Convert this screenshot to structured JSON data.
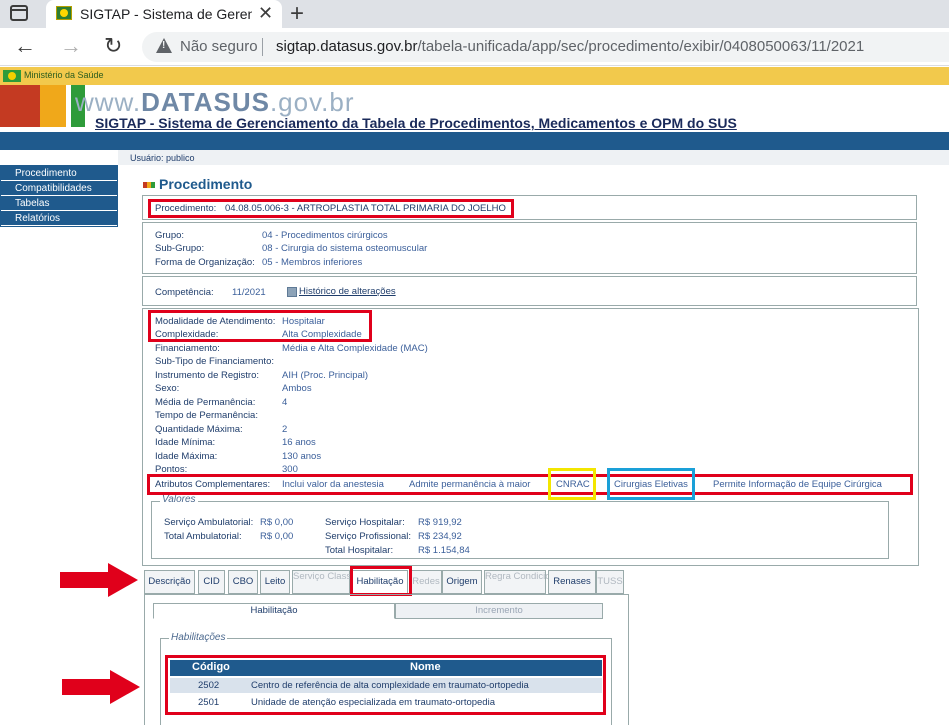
{
  "browser": {
    "tab_title": "SIGTAP - Sistema de Gerenciamento",
    "insecure_label": "Não seguro",
    "url_host": "sigtap.datasus.gov.br",
    "url_path": "/tabela-unificada/app/sec/procedimento/exibir/0408050063/11/2021"
  },
  "header": {
    "ministry": "Ministério da Saúde",
    "logo_prefix": "www.",
    "logo_main": "DATASUS",
    "logo_suffix": ".gov.br",
    "system_title": "SIGTAP - Sistema de Gerenciamento da Tabela de Procedimentos, Medicamentos e OPM do SUS",
    "user_label": "Usuário:",
    "user_value": "publico"
  },
  "menu": [
    "Procedimento",
    "Compatibilidades",
    "Tabelas",
    "Relatórios"
  ],
  "page_title": "Procedimento",
  "procedimento": {
    "label": "Procedimento:",
    "value": "04.08.05.006-3 - ARTROPLASTIA TOTAL PRIMARIA DO JOELHO"
  },
  "grupo": [
    {
      "label": "Grupo:",
      "value": "04 - Procedimentos cirúrgicos"
    },
    {
      "label": "Sub-Grupo:",
      "value": "08 - Cirurgia do sistema osteomuscular"
    },
    {
      "label": "Forma de Organização:",
      "value": "05 - Membros inferiores"
    }
  ],
  "competencia": {
    "label": "Competência:",
    "value": "11/2021",
    "history_link": "Histórico de alterações"
  },
  "details": [
    {
      "label": "Modalidade de Atendimento:",
      "value": "Hospitalar"
    },
    {
      "label": "Complexidade:",
      "value": "Alta Complexidade"
    },
    {
      "label": "Financiamento:",
      "value": "Média e Alta Complexidade (MAC)"
    },
    {
      "label": "Sub-Tipo de Financiamento:",
      "value": ""
    },
    {
      "label": "Instrumento de Registro:",
      "value": "AIH (Proc. Principal)"
    },
    {
      "label": "Sexo:",
      "value": "Ambos"
    },
    {
      "label": "Média de Permanência:",
      "value": "4"
    },
    {
      "label": "Tempo de Permanência:",
      "value": ""
    },
    {
      "label": "Quantidade Máxima:",
      "value": "2"
    },
    {
      "label": "Idade Mínima:",
      "value": "16 anos"
    },
    {
      "label": "Idade Máxima:",
      "value": "130 anos"
    },
    {
      "label": "Pontos:",
      "value": "300"
    }
  ],
  "atributos": {
    "label": "Atributos Complementares:",
    "items": [
      "Inclui valor da anestesia",
      "Admite permanência à maior",
      "CNRAC",
      "Cirurgias Eletivas",
      "Permite Informação de Equipe Cirúrgica"
    ]
  },
  "valores": {
    "legend": "Valores",
    "sa_label": "Serviço Ambulatorial:",
    "sa_value": "R$ 0,00",
    "ta_label": "Total Ambulatorial:",
    "ta_value": "R$ 0,00",
    "sh_label": "Serviço Hospitalar:",
    "sh_value": "R$ 919,92",
    "sp_label": "Serviço Profissional:",
    "sp_value": "R$ 234,92",
    "th_label": "Total Hospitalar:",
    "th_value": "R$ 1.154,84"
  },
  "tabs": [
    {
      "label": "Descrição"
    },
    {
      "label": "CID"
    },
    {
      "label": "CBO"
    },
    {
      "label": "Leito"
    },
    {
      "label": "Serviço Classificação"
    },
    {
      "label": "Habilitação"
    },
    {
      "label": "Redes"
    },
    {
      "label": "Origem"
    },
    {
      "label": "Regra Condicionada"
    },
    {
      "label": "Renases"
    },
    {
      "label": "TUSS"
    }
  ],
  "subtabs": {
    "active": "Habilitação",
    "inactive": "Incremento"
  },
  "habilitacoes": {
    "legend": "Habilitações",
    "col_code": "Código",
    "col_name": "Nome",
    "rows": [
      {
        "code": "2502",
        "name": "Centro de referência de alta complexidade em traumato-ortopedia"
      },
      {
        "code": "2501",
        "name": "Unidade de atenção especializada em traumato-ortopedia"
      }
    ]
  },
  "colors": {
    "annotation_red": "#e0001b",
    "annotation_yellow": "#f3e600",
    "annotation_blue": "#1aa0d8",
    "brand_blue": "#1f5a8d"
  }
}
